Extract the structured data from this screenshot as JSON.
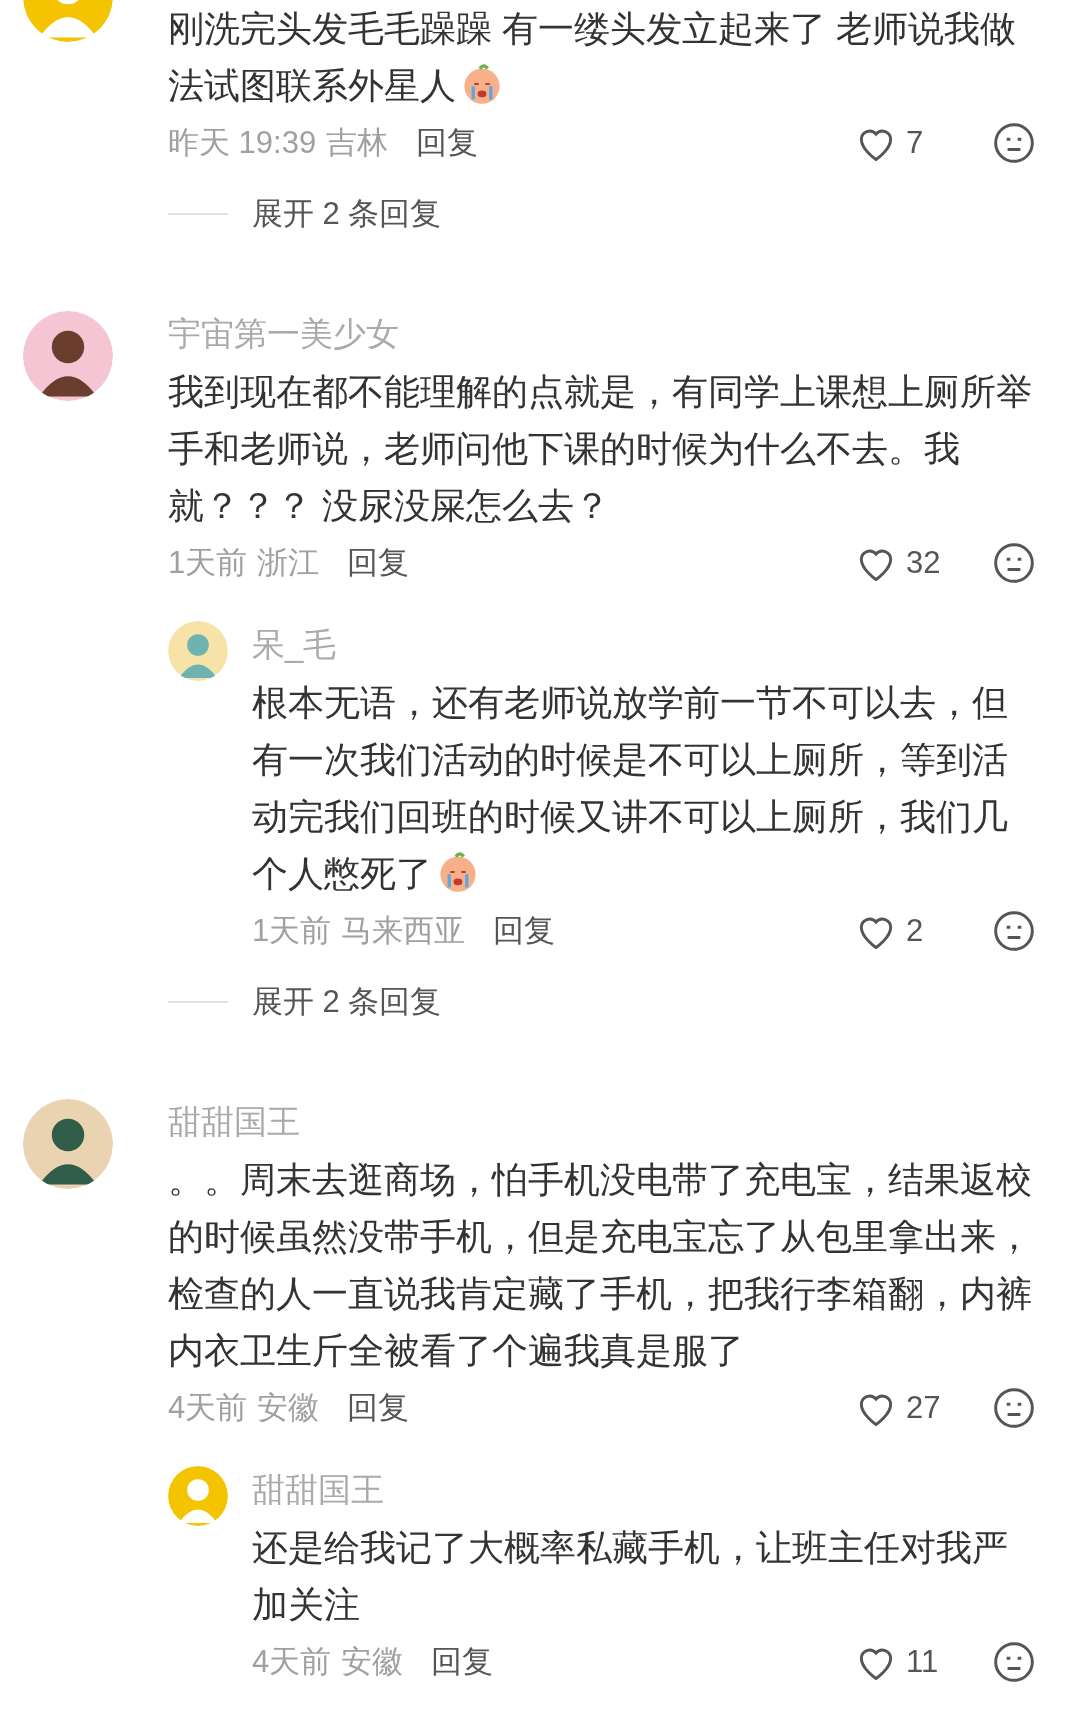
{
  "comments": [
    {
      "text": "刚洗完头发毛毛躁躁 有一缕头发立起来了 老师说我做法试图联系外星人",
      "emoji": true,
      "time": "昨天 19:39",
      "location": "吉林",
      "reply_label": "回复",
      "likes": "7",
      "expand": "展开 2 条回复"
    },
    {
      "name": "宇宙第一美少女",
      "text": "我到现在都不能理解的点就是，有同学上课想上厕所举手和老师说，老师问他下课的时候为什么不去。我就？？？ 没尿没屎怎么去？",
      "emoji": false,
      "time": "1天前",
      "location": "浙江",
      "reply_label": "回复",
      "likes": "32",
      "replies": [
        {
          "name": "呆_毛",
          "text": "根本无语，还有老师说放学前一节不可以去，但有一次我们活动的时候是不可以上厕所，等到活动完我们回班的时候又讲不可以上厕所，我们几个人憋死了",
          "emoji": true,
          "time": "1天前",
          "location": "马来西亚",
          "reply_label": "回复",
          "likes": "2"
        }
      ],
      "expand": "展开 2 条回复"
    },
    {
      "name": "甜甜国王",
      "text": "。。周末去逛商场，怕手机没电带了充电宝，结果返校的时候虽然没带手机，但是充电宝忘了从包里拿出来，检查的人一直说我肯定藏了手机，把我行李箱翻，内裤内衣卫生斤全被看了个遍我真是服了",
      "emoji": false,
      "time": "4天前",
      "location": "安徽",
      "reply_label": "回复",
      "likes": "27",
      "replies": [
        {
          "name": "甜甜国王",
          "text": "还是给我记了大概率私藏手机，让班主任对我严加关注",
          "emoji": false,
          "time": "4天前",
          "location": "安徽",
          "reply_label": "回复",
          "likes": "11"
        }
      ]
    }
  ]
}
